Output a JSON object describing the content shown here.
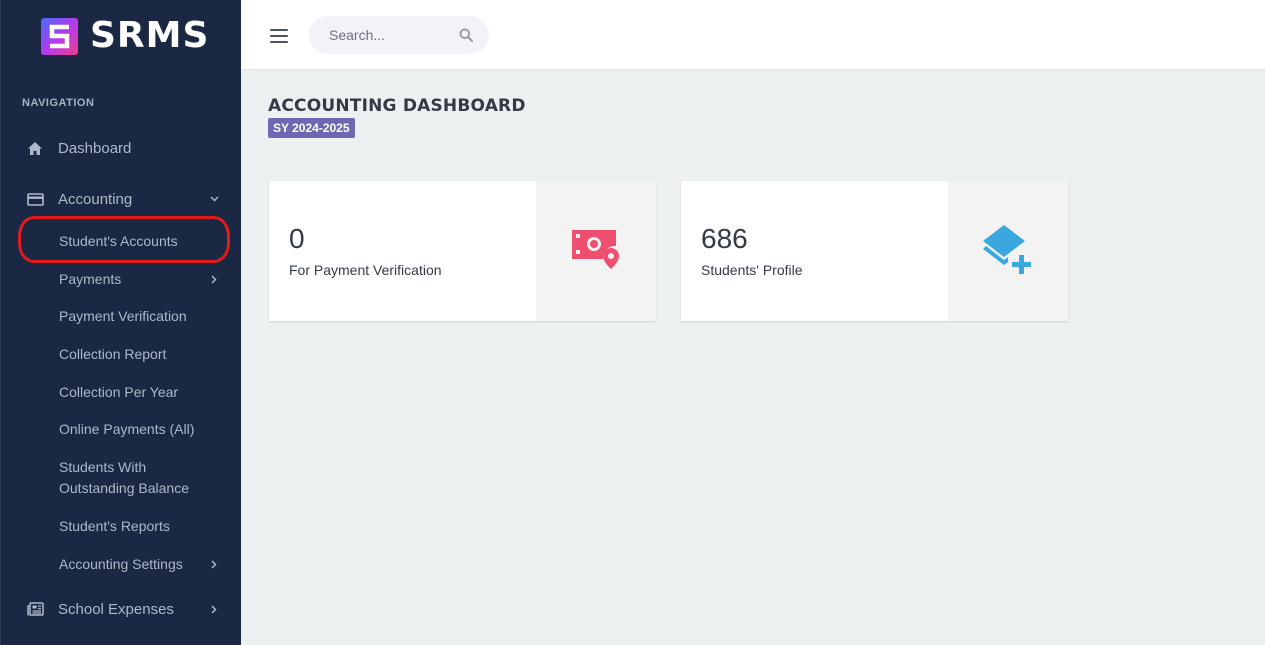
{
  "brand": {
    "name": "SRMS"
  },
  "sidebar": {
    "heading": "NAVIGATION",
    "items": [
      {
        "label": "Dashboard",
        "icon": "home-icon"
      },
      {
        "label": "Accounting",
        "icon": "credit-card-icon",
        "expanded": true
      },
      {
        "label": "School Expenses",
        "icon": "newspaper-icon"
      }
    ],
    "accounting_sub": [
      {
        "label": "Student's Accounts",
        "highlighted": true
      },
      {
        "label": "Payments",
        "has_children": true
      },
      {
        "label": "Payment Verification"
      },
      {
        "label": "Collection Report"
      },
      {
        "label": "Collection Per Year"
      },
      {
        "label": "Online Payments (All)"
      },
      {
        "label": "Students With Outstanding Balance"
      },
      {
        "label": "Student's Reports"
      },
      {
        "label": "Accounting Settings",
        "has_children": true
      }
    ]
  },
  "topbar": {
    "search_placeholder": "Search..."
  },
  "main": {
    "title": "ACCOUNTING DASHBOARD",
    "school_year": "SY 2024-2025",
    "cards": [
      {
        "count": "0",
        "label": "For Payment Verification",
        "icon": "money-location-icon",
        "icon_color": "#ef4f6e"
      },
      {
        "count": "686",
        "label": "Students' Profile",
        "icon": "layers-plus-icon",
        "icon_color": "#3aa8df"
      }
    ]
  },
  "colors": {
    "sidebar_bg": "#1b2843",
    "badge_bg": "#6f66b4",
    "highlight_ring": "#e11b1b",
    "content_bg": "#ecf0f1"
  }
}
